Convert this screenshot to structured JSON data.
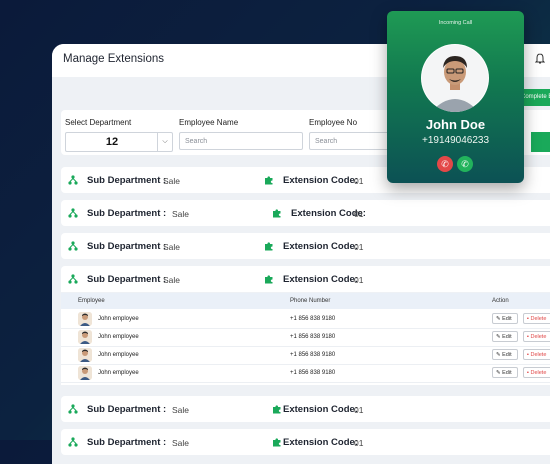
{
  "page": {
    "title": "Manage Extensions"
  },
  "toolbar": {
    "complete_label": "Complete Exten"
  },
  "filters": {
    "department_label": "Select Department",
    "department_value": "12",
    "employee_name_label": "Employee Name",
    "employee_name_placeholder": "Search",
    "employee_no_label": "Employee No",
    "employee_no_placeholder": "Search"
  },
  "rows": [
    {
      "sub_label": "Sub Department :",
      "sub_value": "Sale",
      "ext_label": "Extension Code:",
      "ext_value": "01"
    },
    {
      "sub_label": "Sub Department :",
      "sub_value": "Sale",
      "ext_label": "Extension Code:",
      "ext_value": "01"
    },
    {
      "sub_label": "Sub Department :",
      "sub_value": "Sale",
      "ext_label": "Extension Code:",
      "ext_value": "01"
    },
    {
      "sub_label": "Sub Department :",
      "sub_value": "Sale",
      "ext_label": "Extension Code:",
      "ext_value": "01"
    },
    {
      "sub_label": "Sub Department :",
      "sub_value": "Sale",
      "ext_label": "Extension Code:",
      "ext_value": "01"
    },
    {
      "sub_label": "Sub Department :",
      "sub_value": "Sale",
      "ext_label": "Extension Code:",
      "ext_value": "01"
    }
  ],
  "table": {
    "columns": [
      "Employee",
      "Phone Number",
      "Action"
    ],
    "rows": [
      {
        "name": "John employee",
        "phone": "+1 856 838 9180",
        "edit": "Edit",
        "delete": "Delete"
      },
      {
        "name": "John employee",
        "phone": "+1 856 838 9180",
        "edit": "Edit",
        "delete": "Delete"
      },
      {
        "name": "John employee",
        "phone": "+1 856 838 9180",
        "edit": "Edit",
        "delete": "Delete"
      },
      {
        "name": "John employee",
        "phone": "+1 856 838 9180",
        "edit": "Edit",
        "delete": "Delete"
      }
    ]
  },
  "call": {
    "status": "Incoming Call",
    "caller_name": "John Doe",
    "caller_number": "+19149046233"
  },
  "colors": {
    "accent_green": "#1aa95a",
    "decline_red": "#e34848",
    "delete_red": "#e04848"
  }
}
